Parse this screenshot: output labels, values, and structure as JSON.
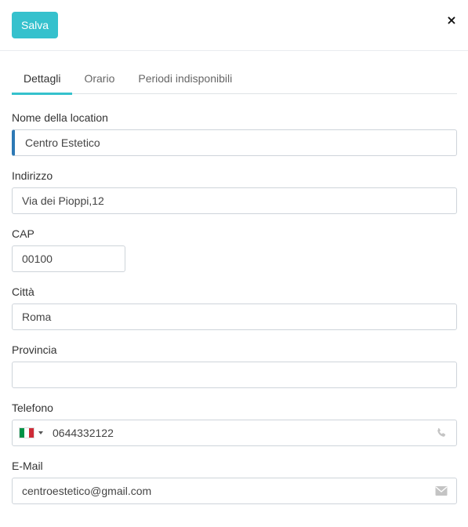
{
  "header": {
    "save_label": "Salva",
    "close_glyph": "×"
  },
  "tabs": [
    {
      "label": "Dettagli",
      "active": true
    },
    {
      "label": "Orario",
      "active": false
    },
    {
      "label": "Periodi indisponibili",
      "active": false
    }
  ],
  "form": {
    "name": {
      "label": "Nome della location",
      "value": "Centro Estetico"
    },
    "address": {
      "label": "Indirizzo",
      "value": "Via dei Pioppi,12"
    },
    "cap": {
      "label": "CAP",
      "value": "00100"
    },
    "city": {
      "label": "Città",
      "value": "Roma"
    },
    "province": {
      "label": "Provincia",
      "value": ""
    },
    "phone": {
      "label": "Telefono",
      "value": "0644332122",
      "country_flag": "italy-flag-icon",
      "icon": "phone-icon"
    },
    "email": {
      "label": "E-Mail",
      "value": "centroestetico@gmail.com",
      "icon": "envelope-icon"
    }
  },
  "colors": {
    "accent": "#35c1cd",
    "focus": "#2d79b5",
    "icon_gray": "#c4c4c4"
  }
}
